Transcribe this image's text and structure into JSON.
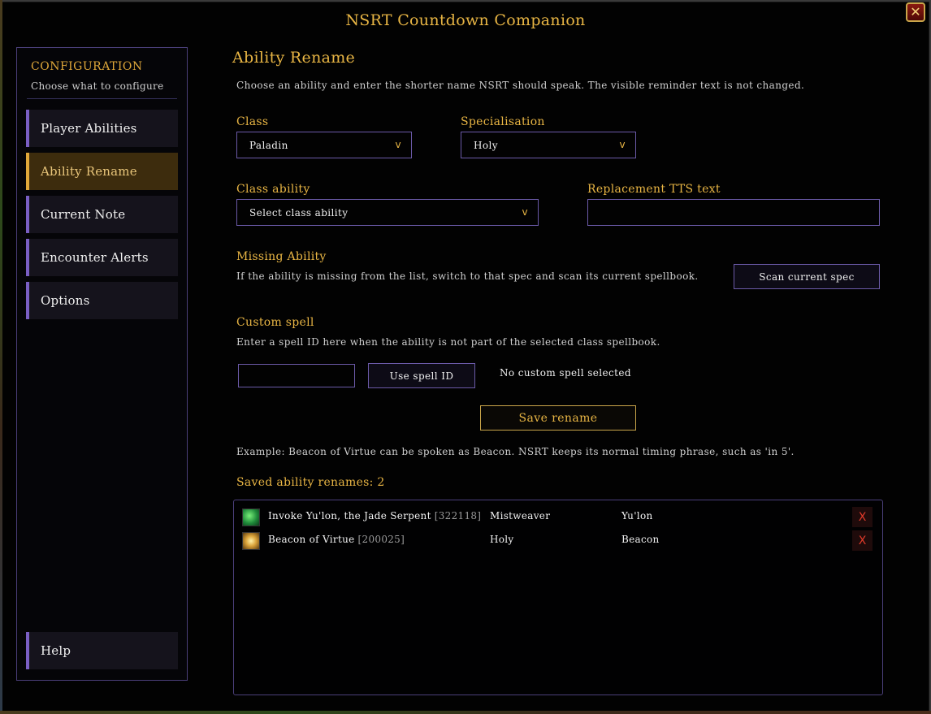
{
  "window": {
    "title": "NSRT Countdown Companion",
    "close_label": "✕"
  },
  "sidebar": {
    "heading": "CONFIGURATION",
    "subheading": "Choose what to configure",
    "items": [
      {
        "label": "Player Abilities"
      },
      {
        "label": "Ability Rename"
      },
      {
        "label": "Current Note"
      },
      {
        "label": "Encounter Alerts"
      },
      {
        "label": "Options"
      }
    ],
    "help_label": "Help"
  },
  "main": {
    "title": "Ability Rename",
    "description": "Choose an ability and enter the shorter name NSRT should speak. The visible reminder text is not changed.",
    "class_label": "Class",
    "class_value": "Paladin",
    "spec_label": "Specialisation",
    "spec_value": "Holy",
    "chevron": "v",
    "ability_label": "Class ability",
    "ability_value": "Select class ability",
    "tts_label": "Replacement TTS text",
    "tts_value": "",
    "missing_title": "Missing Ability",
    "missing_desc": "If the ability is missing from the list, switch to that spec and scan its current spellbook.",
    "scan_button": "Scan current spec",
    "custom_title": "Custom spell",
    "custom_desc": "Enter a spell ID here when the ability is not part of the selected class spellbook.",
    "spell_id_value": "",
    "use_spell_button": "Use spell ID",
    "custom_status": "No custom spell selected",
    "save_button": "Save rename",
    "example": "Example: Beacon of Virtue can be spoken as Beacon. NSRT keeps its normal timing phrase, such as 'in 5'.",
    "saved_heading": "Saved ability renames: 2"
  },
  "renames": [
    {
      "icon": "jade-serpent-icon",
      "name": "Invoke Yu'lon, the Jade Serpent",
      "spell_id": "[322118]",
      "spec": "Mistweaver",
      "replacement": "Yu'lon",
      "delete": "X"
    },
    {
      "icon": "beacon-of-virtue-icon",
      "name": "Beacon of Virtue",
      "spell_id": "[200025]",
      "spec": "Holy",
      "replacement": "Beacon",
      "delete": "X"
    }
  ],
  "colors": {
    "gold": "#e8b544",
    "purple_border": "#6b5aa8",
    "active_bg": "#3d2c0d",
    "delete_red": "#e03a2a"
  }
}
